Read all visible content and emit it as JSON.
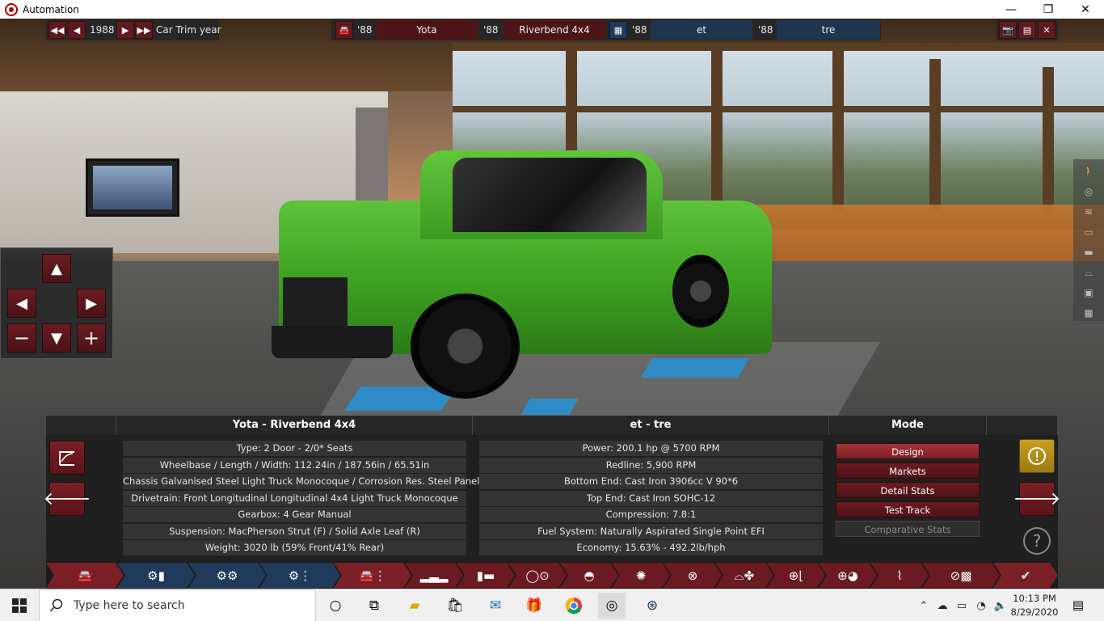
{
  "window": {
    "title": "Automation",
    "buttons": [
      "—",
      "❐",
      "✕"
    ]
  },
  "top_toolbar": {
    "year": "1988",
    "year_label": "Car Trim year",
    "car_model_year": "'88",
    "car_model": "Yota",
    "car_trim_year": "'88",
    "car_trim": "Riverbend 4x4",
    "engine_family_year": "'88",
    "engine_family": "et",
    "engine_variant_year": "'88",
    "engine_variant": "tre"
  },
  "camera_pad": {
    "up": "▲",
    "left": "◀",
    "right": "▶",
    "zoom_out": "−",
    "down": "▼",
    "zoom_in": "+"
  },
  "car_panel": {
    "title": "Yota - Riverbend 4x4",
    "rows": [
      "Type: 2 Door - 2/0* Seats",
      "Wheelbase / Length / Width: 112.24in / 187.56in / 65.51in",
      "Chassis Galvanised Steel Light Truck Monocoque / Corrosion Res. Steel Panels",
      "Drivetrain: Front Longitudinal Longitudinal 4x4 Light Truck Monocoque",
      "Gearbox: 4 Gear Manual",
      "Suspension: MacPherson Strut (F) / Solid Axle Leaf (R)",
      "Weight: 3020 lb (59% Front/41% Rear)"
    ]
  },
  "engine_panel": {
    "title": "et - tre",
    "rows": [
      "Power: 200.1 hp @ 5700 RPM",
      "Redline:  5,900 RPM",
      "Bottom End: Cast Iron 3906cc V 90*6",
      "Top End: Cast Iron SOHC-12",
      "Compression: 7.8:1",
      "Fuel System: Naturally Aspirated Single Point EFI",
      "Economy: 15.63% - 492.2lb/hph"
    ]
  },
  "mode_panel": {
    "title": "Mode",
    "buttons": [
      "Design",
      "Markets",
      "Detail Stats",
      "Test Track",
      "Comparative Stats"
    ]
  },
  "taskbar": {
    "search_placeholder": "Type here to search",
    "time": "10:13 PM",
    "date": "8/29/2020"
  },
  "colors": {
    "accent_red": "#7a1f26",
    "accent_blue": "#1f3a5a",
    "truck_green": "#3fa322"
  }
}
